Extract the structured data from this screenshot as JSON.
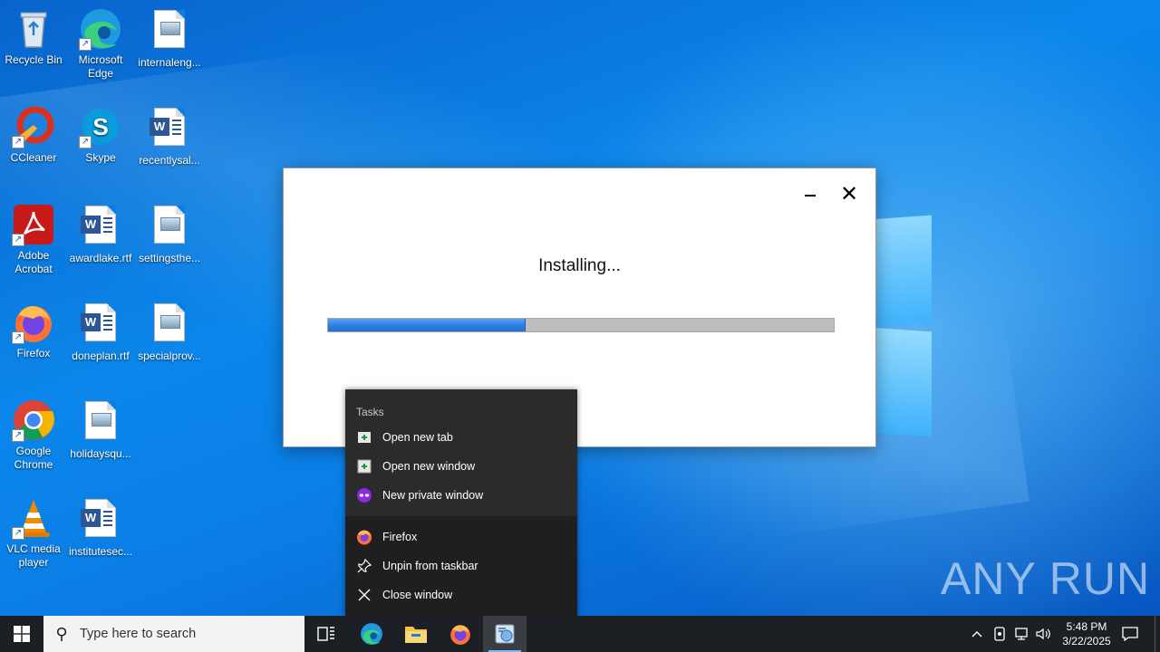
{
  "desktop_icons": [
    {
      "label": "Recycle Bin",
      "kind": "recycle-bin"
    },
    {
      "label": "Microsoft Edge",
      "kind": "edge"
    },
    {
      "label": "internaleng...",
      "kind": "image-doc"
    },
    {
      "label": "CCleaner",
      "kind": "ccleaner"
    },
    {
      "label": "Skype",
      "kind": "skype"
    },
    {
      "label": "recentlysal...",
      "kind": "word-doc"
    },
    {
      "label": "Adobe Acrobat",
      "kind": "acrobat"
    },
    {
      "label": "awardlake.rtf",
      "kind": "word-doc"
    },
    {
      "label": "settingsthe...",
      "kind": "image-doc"
    },
    {
      "label": "Firefox",
      "kind": "firefox"
    },
    {
      "label": "doneplan.rtf",
      "kind": "word-doc"
    },
    {
      "label": "specialprov...",
      "kind": "image-doc"
    },
    {
      "label": "Google Chrome",
      "kind": "chrome"
    },
    {
      "label": "holidaysqu...",
      "kind": "image-doc"
    },
    {
      "label": "VLC media player",
      "kind": "vlc"
    },
    {
      "label": "institutesec...",
      "kind": "word-doc"
    }
  ],
  "installer": {
    "status_text": "Installing...",
    "progress_percent": 39,
    "minimize_icon": "minimize-icon",
    "close_icon": "close-icon"
  },
  "jumplist": {
    "section_title": "Tasks",
    "tasks": [
      {
        "label": "Open new tab",
        "icon": "new-tab-icon"
      },
      {
        "label": "Open new window",
        "icon": "new-window-icon"
      },
      {
        "label": "New private window",
        "icon": "private-mask-icon"
      }
    ],
    "actions": [
      {
        "label": "Firefox",
        "icon": "firefox-icon"
      },
      {
        "label": "Unpin from taskbar",
        "icon": "unpin-icon"
      },
      {
        "label": "Close window",
        "icon": "close-icon"
      }
    ]
  },
  "taskbar": {
    "search_placeholder": "Type here to search",
    "time": "5:48 PM",
    "date": "3/22/2025"
  },
  "watermark": "ANY RUN"
}
